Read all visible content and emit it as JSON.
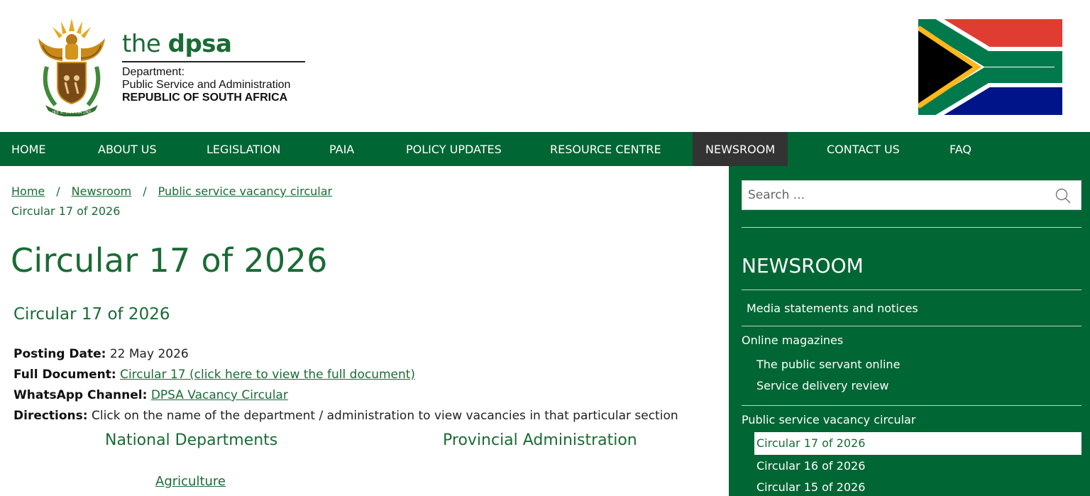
{
  "brand": {
    "name_light": "the ",
    "name_bold": "dpsa",
    "line1": "Department:",
    "line2": "Public Service and Administration",
    "line3": "REPUBLIC OF SOUTH AFRICA",
    "green": "#006633"
  },
  "nav": {
    "items": [
      "HOME",
      "ABOUT US",
      "LEGISLATION",
      "PAIA",
      "POLICY UPDATES",
      "RESOURCE CENTRE",
      "NEWSROOM",
      "CONTACT US",
      "FAQ"
    ],
    "active": "NEWSROOM"
  },
  "breadcrumb": {
    "home": "Home",
    "sep": "/",
    "newsroom": "Newsroom",
    "circular": "Public service vacancy circular",
    "current": "Circular 17 of 2026"
  },
  "main": {
    "title": "Circular 17 of 2026",
    "subtitle": "Circular 17 of 2026",
    "posting_label": "Posting Date:",
    "posting_value": " 22 May 2026",
    "fulldoc_label": "Full Document:",
    "fulldoc_link": "Circular 17 (click here to view the full document)",
    "whatsapp_label": "WhatsApp Channel:",
    "whatsapp_link": "DPSA Vacancy Circular",
    "directions_label": "Directions:",
    "directions_value": " Click on the name of the department / administration to view vacancies in that particular section",
    "col_national": "National Departments",
    "col_provincial": "Provincial Administration",
    "first_dept": "Agriculture"
  },
  "sidebar": {
    "search_placeholder": "Search ...",
    "heading": "NEWSROOM",
    "media": "Media statements and notices",
    "online": "Online magazines",
    "public_servant": "The public servant online",
    "service_delivery": "Service delivery review",
    "vacancy": "Public service vacancy circular",
    "circular17": "Circular 17 of 2026",
    "circular16": "Circular 16 of 2026",
    "circular15": "Circular 15 of 2026"
  }
}
